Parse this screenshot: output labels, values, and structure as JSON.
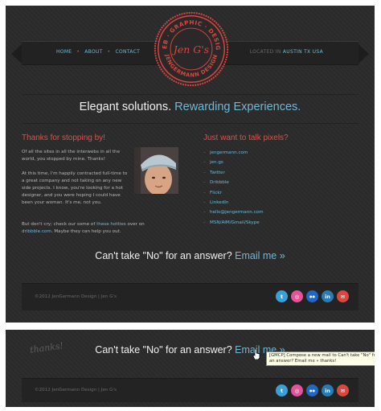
{
  "nav": {
    "items": [
      {
        "label": "HOME"
      },
      {
        "label": "ABOUT"
      },
      {
        "label": "CONTACT"
      }
    ]
  },
  "location": {
    "prefix": "LOCATED IN",
    "city": "AUSTIN TX USA"
  },
  "seal": {
    "top_text": "WEB · GRAPHIC · DESIGN",
    "name": "Jen G's",
    "bottom_text": "JENGERMANN DESIGN"
  },
  "tagline": {
    "text": "Elegant solutions.",
    "highlight": "Rewarding Experiences."
  },
  "intro": {
    "heading": "Thanks for stopping by!",
    "p1": "Of all the sites in all the interwebs in all the world, you stopped by mine. Thanks!",
    "p2": "At this time, I'm happily contracted full-time to a great company and not taking on any new side projects. I know, you're looking for a hot designer, and you were hoping I could have been your woman. It's me, not you.",
    "p3_before": "But don't cry; check our some of",
    "p3_link1": "these hotties",
    "p3_mid": "over on",
    "p3_link2": "dribbble.com",
    "p3_after": ". Maybe they can help you out."
  },
  "contact": {
    "heading": "Just want to talk pixels?",
    "links": [
      {
        "label": "jengermann.com"
      },
      {
        "label": "jen.gs"
      },
      {
        "label": "Twitter"
      },
      {
        "label": "Dribbble"
      },
      {
        "label": "Flickr"
      },
      {
        "label": "LinkedIn"
      },
      {
        "label": "hello@jengermann.com"
      },
      {
        "label": "MSN/AIM/Gmail/Skype"
      }
    ]
  },
  "cta": {
    "text": "Can't take \"No\" for an answer?",
    "link": "Email me »"
  },
  "footer": {
    "copyright": "©2012 JenGermann Design | Jen G's"
  },
  "social": [
    {
      "icon": "twitter-icon",
      "glyph": "t",
      "color": "#3aa0d8"
    },
    {
      "icon": "dribbble-icon",
      "glyph": "◎",
      "color": "#e0559a"
    },
    {
      "icon": "flickr-icon",
      "glyph": "●●",
      "color": "#1f68c4"
    },
    {
      "icon": "linkedin-icon",
      "glyph": "in",
      "color": "#2b7bb3"
    },
    {
      "icon": "email-icon",
      "glyph": "✉",
      "color": "#d9473f"
    }
  ],
  "zoom": {
    "signature": "thanks!",
    "cta_text": "Can't take \"No\" for an answer?",
    "cta_link": "Email me »",
    "tooltip": "[GMCP] Compose a new mail to Can't take \"No\" for an answer? Email me » thanks!",
    "copyright": "©2012 JenGermann Design | Jen G's"
  },
  "colors": {
    "accent_blue": "#6fb8d6",
    "accent_red": "#d9534a",
    "background": "#2c2b2b"
  }
}
